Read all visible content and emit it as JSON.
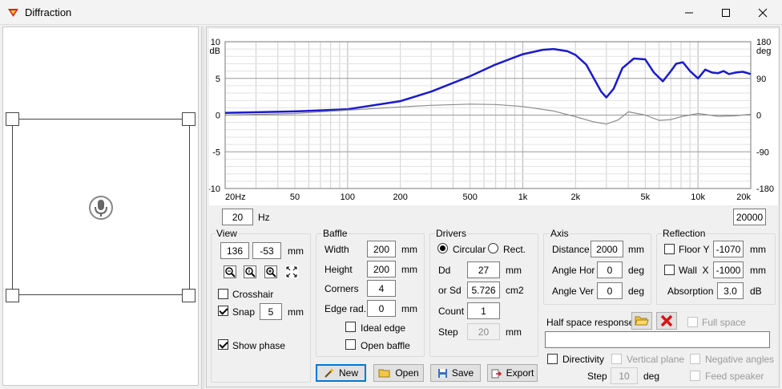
{
  "window": {
    "title": "Diffraction"
  },
  "chart": {
    "left_unit": "dB",
    "right_unit": "deg",
    "y_left_ticks": [
      "10",
      "5",
      "0",
      "-5",
      "-10"
    ],
    "y_right_ticks": [
      "180",
      "90",
      "0",
      "-90",
      "-180"
    ],
    "x_ticks": [
      "20Hz",
      "50",
      "100",
      "200",
      "500",
      "1k",
      "2k",
      "5k",
      "10k",
      "20k"
    ],
    "colors": {
      "magnitude": "#1a1acc",
      "phase": "#8c8c8c",
      "grid": "#d0d0d0"
    }
  },
  "chart_data": {
    "type": "line",
    "xlabel": "",
    "ylabel": "dB",
    "y2label": "deg",
    "xscale": "log",
    "xlim": [
      20,
      20000
    ],
    "ylim": [
      -10,
      10
    ],
    "y2lim": [
      -180,
      180
    ],
    "grid": true,
    "series": [
      {
        "axis": "left",
        "x": [
          20,
          50,
          100,
          200,
          300,
          500,
          700,
          1000,
          1300,
          1500,
          1800,
          2000,
          2300,
          2600,
          2800,
          3000,
          3300,
          3700,
          4300,
          5000,
          5600,
          6300,
          7000,
          7500,
          8200,
          9000,
          10000,
          11000,
          12000,
          13000,
          14000,
          15000,
          16500,
          18000,
          20000
        ],
        "y": [
          0.3,
          0.5,
          0.8,
          1.9,
          3.2,
          5.3,
          6.9,
          8.3,
          8.9,
          9.0,
          8.7,
          8.2,
          6.9,
          4.6,
          3.2,
          2.4,
          3.6,
          6.4,
          7.7,
          7.6,
          5.8,
          4.6,
          6.0,
          7.0,
          7.2,
          6.0,
          5.0,
          6.2,
          5.8,
          5.7,
          6.0,
          5.6,
          5.8,
          5.9,
          5.6
        ]
      },
      {
        "axis": "right",
        "x": [
          20,
          50,
          100,
          200,
          300,
          500,
          700,
          1000,
          1500,
          2000,
          2500,
          3000,
          3500,
          4000,
          5000,
          6000,
          7000,
          8000,
          10000,
          13000,
          16000,
          20000
        ],
        "y": [
          0,
          4,
          12,
          20,
          24,
          27,
          26,
          21,
          10,
          -4,
          -16,
          -22,
          -12,
          8,
          0,
          -13,
          -11,
          -4,
          4,
          -3,
          -2,
          2
        ]
      }
    ]
  },
  "range": {
    "min": "20",
    "max": "20000",
    "unit": "Hz"
  },
  "view": {
    "title": "View",
    "x": "136",
    "y": "-53",
    "unit": "mm",
    "crosshair_label": "Crosshair",
    "snap_label": "Snap",
    "snap_value": "5",
    "snap_unit": "mm",
    "show_phase_label": "Show phase"
  },
  "baffle": {
    "title": "Baffle",
    "width_label": "Width",
    "width_value": "200",
    "width_unit": "mm",
    "height_label": "Height",
    "height_value": "200",
    "height_unit": "mm",
    "corners_label": "Corners",
    "corners_value": "4",
    "edge_label": "Edge rad.",
    "edge_value": "0",
    "edge_unit": "mm",
    "ideal_edge_label": "Ideal edge",
    "open_baffle_label": "Open baffle"
  },
  "drivers": {
    "title": "Drivers",
    "circular_label": "Circular",
    "rect_label": "Rect.",
    "dd_label": "Dd",
    "dd_value": "27",
    "dd_unit": "mm",
    "sd_label": "or Sd",
    "sd_value": "5.726",
    "sd_unit": "cm2",
    "count_label": "Count",
    "count_value": "1",
    "step_label": "Step",
    "step_value": "20",
    "step_unit": "mm"
  },
  "axis": {
    "title": "Axis",
    "distance_label": "Distance",
    "distance_value": "2000",
    "distance_unit": "mm",
    "hor_label": "Angle Hor",
    "hor_value": "0",
    "hor_unit": "deg",
    "ver_label": "Angle Ver",
    "ver_value": "0",
    "ver_unit": "deg"
  },
  "reflection": {
    "title": "Reflection",
    "floor_label": "Floor Y",
    "floor_value": "-1070",
    "floor_unit": "mm",
    "wall_label": "Wall  X",
    "wall_value": "-1000",
    "wall_unit": "mm",
    "absorption_label": "Absorption",
    "absorption_value": "3.0",
    "absorption_unit": "dB"
  },
  "halfspace": {
    "label": "Half space response",
    "full_space_label": "Full space",
    "path_value": ""
  },
  "directivity": {
    "label": "Directivity",
    "vertical_label": "Vertical plane",
    "negative_label": "Negative angles",
    "feed_label": "Feed speaker",
    "step_label": "Step",
    "step_value": "10",
    "step_unit": "deg"
  },
  "buttons": {
    "new": "New",
    "open": "Open",
    "save": "Save",
    "export": "Export"
  }
}
